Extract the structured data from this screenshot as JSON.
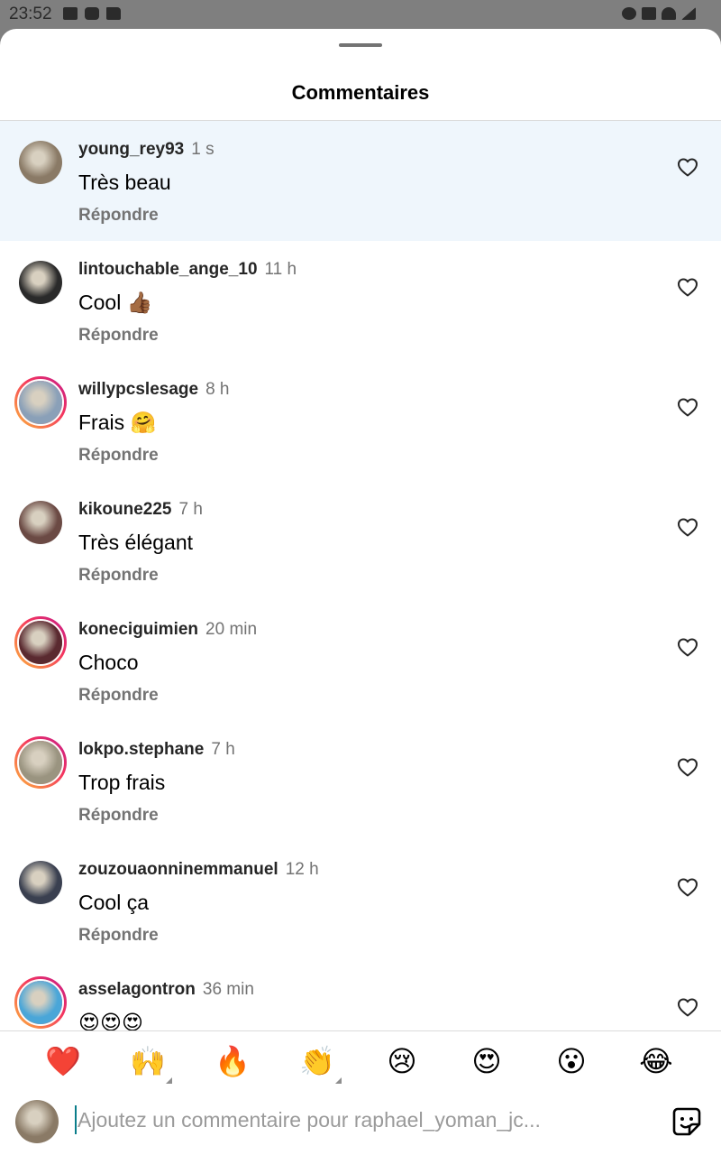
{
  "status_bar": {
    "time": "23:52",
    "left_icons": [
      "image-icon",
      "youtube-icon",
      "folder-icon"
    ],
    "right_icons": [
      "alarm-icon",
      "mute-icon",
      "wifi-icon",
      "signal-icon"
    ]
  },
  "sheet": {
    "title": "Commentaires"
  },
  "reply_label": "Répondre",
  "comments": [
    {
      "user": "young_rey93",
      "time": "1 s",
      "text": "Très beau",
      "ring": false,
      "highlight": true,
      "avatar_color": "#8a7a66"
    },
    {
      "user": "lintouchable_ange_10",
      "time": "11 h",
      "text": "Cool 👍🏾",
      "ring": false,
      "highlight": false,
      "avatar_color": "#2a2a2a"
    },
    {
      "user": "willypcslesage",
      "time": "8 h",
      "text": "Frais 🤗",
      "ring": true,
      "highlight": false,
      "avatar_color": "#8aa0b8"
    },
    {
      "user": "kikoune225",
      "time": "7 h",
      "text": "Très élégant",
      "ring": false,
      "highlight": false,
      "avatar_color": "#6b4a44"
    },
    {
      "user": "koneciguimien",
      "time": "20 min",
      "text": "Choco",
      "ring": true,
      "highlight": false,
      "avatar_color": "#5a2a30"
    },
    {
      "user": "lokpo.stephane",
      "time": "7 h",
      "text": "Trop frais",
      "ring": true,
      "highlight": false,
      "avatar_color": "#9a9480"
    },
    {
      "user": "zouzouaonninemmanuel",
      "time": "12 h",
      "text": "Cool ça",
      "ring": false,
      "highlight": false,
      "avatar_color": "#3a4050"
    },
    {
      "user": "asselagontron",
      "time": "36 min",
      "text": "😍😍😍",
      "ring": true,
      "highlight": false,
      "avatar_color": "#4aa6d8"
    }
  ],
  "reactions": [
    {
      "emoji": "❤️",
      "name": "heart-emoji",
      "more": false
    },
    {
      "emoji": "🙌",
      "name": "raised-hands-emoji",
      "more": true
    },
    {
      "emoji": "🔥",
      "name": "fire-emoji",
      "more": false
    },
    {
      "emoji": "👏",
      "name": "clapping-emoji",
      "more": true
    },
    {
      "emoji": "😢",
      "name": "crying-emoji",
      "more": false
    },
    {
      "emoji": "😍",
      "name": "heart-eyes-emoji",
      "more": false
    },
    {
      "emoji": "😮",
      "name": "surprised-emoji",
      "more": false
    },
    {
      "emoji": "😂",
      "name": "tears-of-joy-emoji",
      "more": false
    }
  ],
  "composer": {
    "placeholder": "Ajoutez un commentaire pour raphael_yoman_jc...",
    "avatar_color": "#8a7a66"
  },
  "colors": {
    "highlight_bg": "#eff6fc",
    "secondary_text": "#737373",
    "story_ring": [
      "#fdb53c",
      "#f4365f",
      "#c1198b"
    ]
  }
}
